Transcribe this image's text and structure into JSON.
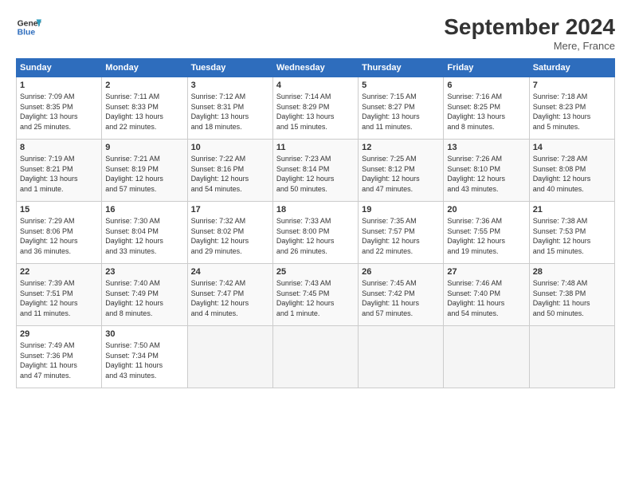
{
  "header": {
    "logo_line1": "General",
    "logo_line2": "Blue",
    "month": "September 2024",
    "location": "Mere, France"
  },
  "weekdays": [
    "Sunday",
    "Monday",
    "Tuesday",
    "Wednesday",
    "Thursday",
    "Friday",
    "Saturday"
  ],
  "weeks": [
    [
      {
        "day": "1",
        "info": "Sunrise: 7:09 AM\nSunset: 8:35 PM\nDaylight: 13 hours\nand 25 minutes."
      },
      {
        "day": "2",
        "info": "Sunrise: 7:11 AM\nSunset: 8:33 PM\nDaylight: 13 hours\nand 22 minutes."
      },
      {
        "day": "3",
        "info": "Sunrise: 7:12 AM\nSunset: 8:31 PM\nDaylight: 13 hours\nand 18 minutes."
      },
      {
        "day": "4",
        "info": "Sunrise: 7:14 AM\nSunset: 8:29 PM\nDaylight: 13 hours\nand 15 minutes."
      },
      {
        "day": "5",
        "info": "Sunrise: 7:15 AM\nSunset: 8:27 PM\nDaylight: 13 hours\nand 11 minutes."
      },
      {
        "day": "6",
        "info": "Sunrise: 7:16 AM\nSunset: 8:25 PM\nDaylight: 13 hours\nand 8 minutes."
      },
      {
        "day": "7",
        "info": "Sunrise: 7:18 AM\nSunset: 8:23 PM\nDaylight: 13 hours\nand 5 minutes."
      }
    ],
    [
      {
        "day": "8",
        "info": "Sunrise: 7:19 AM\nSunset: 8:21 PM\nDaylight: 13 hours\nand 1 minute."
      },
      {
        "day": "9",
        "info": "Sunrise: 7:21 AM\nSunset: 8:19 PM\nDaylight: 12 hours\nand 57 minutes."
      },
      {
        "day": "10",
        "info": "Sunrise: 7:22 AM\nSunset: 8:16 PM\nDaylight: 12 hours\nand 54 minutes."
      },
      {
        "day": "11",
        "info": "Sunrise: 7:23 AM\nSunset: 8:14 PM\nDaylight: 12 hours\nand 50 minutes."
      },
      {
        "day": "12",
        "info": "Sunrise: 7:25 AM\nSunset: 8:12 PM\nDaylight: 12 hours\nand 47 minutes."
      },
      {
        "day": "13",
        "info": "Sunrise: 7:26 AM\nSunset: 8:10 PM\nDaylight: 12 hours\nand 43 minutes."
      },
      {
        "day": "14",
        "info": "Sunrise: 7:28 AM\nSunset: 8:08 PM\nDaylight: 12 hours\nand 40 minutes."
      }
    ],
    [
      {
        "day": "15",
        "info": "Sunrise: 7:29 AM\nSunset: 8:06 PM\nDaylight: 12 hours\nand 36 minutes."
      },
      {
        "day": "16",
        "info": "Sunrise: 7:30 AM\nSunset: 8:04 PM\nDaylight: 12 hours\nand 33 minutes."
      },
      {
        "day": "17",
        "info": "Sunrise: 7:32 AM\nSunset: 8:02 PM\nDaylight: 12 hours\nand 29 minutes."
      },
      {
        "day": "18",
        "info": "Sunrise: 7:33 AM\nSunset: 8:00 PM\nDaylight: 12 hours\nand 26 minutes."
      },
      {
        "day": "19",
        "info": "Sunrise: 7:35 AM\nSunset: 7:57 PM\nDaylight: 12 hours\nand 22 minutes."
      },
      {
        "day": "20",
        "info": "Sunrise: 7:36 AM\nSunset: 7:55 PM\nDaylight: 12 hours\nand 19 minutes."
      },
      {
        "day": "21",
        "info": "Sunrise: 7:38 AM\nSunset: 7:53 PM\nDaylight: 12 hours\nand 15 minutes."
      }
    ],
    [
      {
        "day": "22",
        "info": "Sunrise: 7:39 AM\nSunset: 7:51 PM\nDaylight: 12 hours\nand 11 minutes."
      },
      {
        "day": "23",
        "info": "Sunrise: 7:40 AM\nSunset: 7:49 PM\nDaylight: 12 hours\nand 8 minutes."
      },
      {
        "day": "24",
        "info": "Sunrise: 7:42 AM\nSunset: 7:47 PM\nDaylight: 12 hours\nand 4 minutes."
      },
      {
        "day": "25",
        "info": "Sunrise: 7:43 AM\nSunset: 7:45 PM\nDaylight: 12 hours\nand 1 minute."
      },
      {
        "day": "26",
        "info": "Sunrise: 7:45 AM\nSunset: 7:42 PM\nDaylight: 11 hours\nand 57 minutes."
      },
      {
        "day": "27",
        "info": "Sunrise: 7:46 AM\nSunset: 7:40 PM\nDaylight: 11 hours\nand 54 minutes."
      },
      {
        "day": "28",
        "info": "Sunrise: 7:48 AM\nSunset: 7:38 PM\nDaylight: 11 hours\nand 50 minutes."
      }
    ],
    [
      {
        "day": "29",
        "info": "Sunrise: 7:49 AM\nSunset: 7:36 PM\nDaylight: 11 hours\nand 47 minutes."
      },
      {
        "day": "30",
        "info": "Sunrise: 7:50 AM\nSunset: 7:34 PM\nDaylight: 11 hours\nand 43 minutes."
      },
      {
        "day": "",
        "info": ""
      },
      {
        "day": "",
        "info": ""
      },
      {
        "day": "",
        "info": ""
      },
      {
        "day": "",
        "info": ""
      },
      {
        "day": "",
        "info": ""
      }
    ]
  ]
}
